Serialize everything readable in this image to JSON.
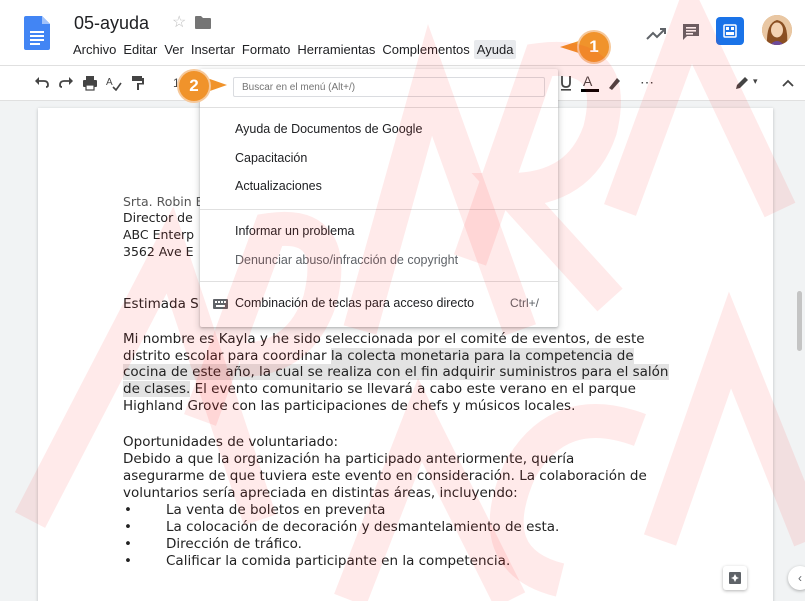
{
  "doc": {
    "title": "05-ayuda"
  },
  "menubar": [
    "Archivo",
    "Editar",
    "Ver",
    "Insertar",
    "Formato",
    "Herramientas",
    "Complementos",
    "Ayuda"
  ],
  "toolbar": {
    "fontsize_partial": "1"
  },
  "help_menu": {
    "search_placeholder": "Buscar en el menú (Alt+/)",
    "items": [
      "Ayuda de Documentos de Google",
      "Capacitación",
      "Actualizaciones"
    ],
    "items2": [
      "Informar un problema",
      "Denunciar abuso/infracción de copyright"
    ],
    "shortcut_label": "Combinación de teclas para acceso directo",
    "shortcut_keys": "Ctrl+/"
  },
  "callouts": [
    "1",
    "2"
  ],
  "letter": {
    "address": [
      "Srta. Robin E",
      "Director de",
      "ABC Enterp",
      "3562 Ave E"
    ],
    "greeting": "Estimada S",
    "p1": [
      {
        "pre": "Mi nombre es Kayla y he sido seleccionada por el comité de eventos, de este",
        "hl": "",
        "post": ""
      },
      {
        "pre": "distrito escolar para coordinar ",
        "hl": "la colecta monetaria para la competencia de",
        "post": ""
      },
      {
        "pre": "",
        "hl": "cocina de este año, la cual se realiza con el fin adquirir suministros para el salón",
        "post": ""
      },
      {
        "pre": "",
        "hl": "de clases.",
        "post": " El evento comunitario se llevará a cabo este verano en el parque"
      },
      {
        "pre": "Highland Grove con las participaciones de chefs y músicos locales.",
        "hl": "",
        "post": ""
      }
    ],
    "p2_heading": "Oportunidades de voluntariado:",
    "p2": [
      "Debido a que la organización ha participado anteriormente, quería",
      "asegurarme de que tuviera este evento en consideración. La colaboración de",
      "voluntarios sería apreciada en distintas áreas, incluyendo:"
    ],
    "bullets": [
      "La venta de boletos en preventa",
      "La colocación de decoración y desmantelamiento de esta.",
      "Dirección de tráfico.",
      "Calificar la comida participante en la competencia."
    ]
  },
  "colors": {
    "accent": "#1a73e8",
    "callout": "#f0932b",
    "watermark": "#ff0000"
  }
}
